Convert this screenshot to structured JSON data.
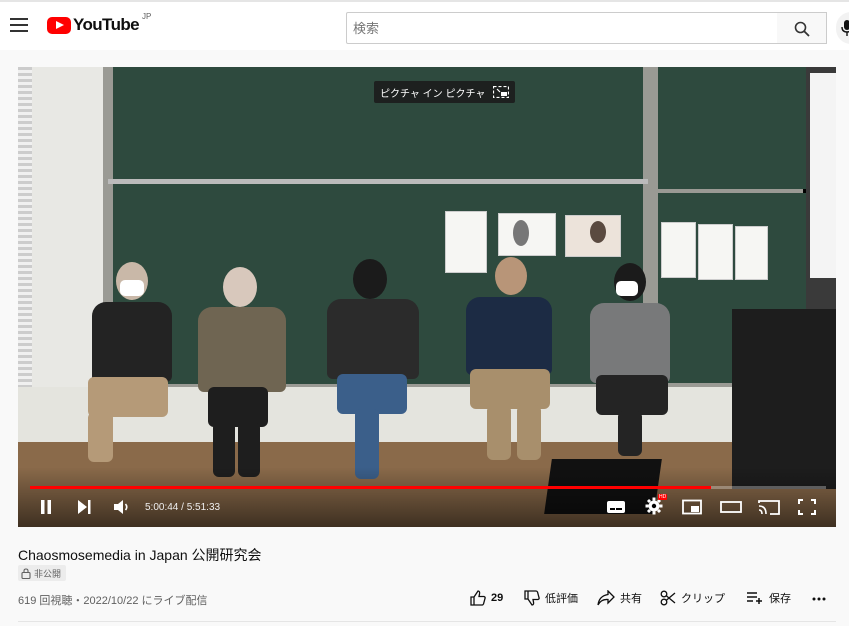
{
  "header": {
    "logo_text": "YouTube",
    "region": "JP",
    "search_placeholder": "検索"
  },
  "player": {
    "pip_tooltip": "ピクチャ イン ピクチャ",
    "current_time": "5:00:44",
    "duration": "5:51:33",
    "time_display": "5:00:44 / 5:51:33",
    "progress_fraction": 0.855,
    "hd_badge": "HD",
    "accent_color": "#ff0000"
  },
  "video": {
    "title": "Chaosmosemedia in Japan 公開研究会",
    "privacy_badge": "非公開",
    "meta": "619 回視聴・2022/10/22 にライブ配信"
  },
  "actions": {
    "like_count": "29",
    "dislike_label": "低評価",
    "share_label": "共有",
    "clip_label": "クリップ",
    "save_label": "保存"
  },
  "icons": [
    "menu-icon",
    "search-icon",
    "mic-icon",
    "pause-icon",
    "next-icon",
    "volume-icon",
    "subtitles-icon",
    "settings-icon",
    "miniplayer-icon",
    "theater-icon",
    "cast-icon",
    "fullscreen-icon",
    "like-icon",
    "dislike-icon",
    "share-icon",
    "clip-icon",
    "save-icon",
    "more-icon",
    "lock-icon"
  ]
}
